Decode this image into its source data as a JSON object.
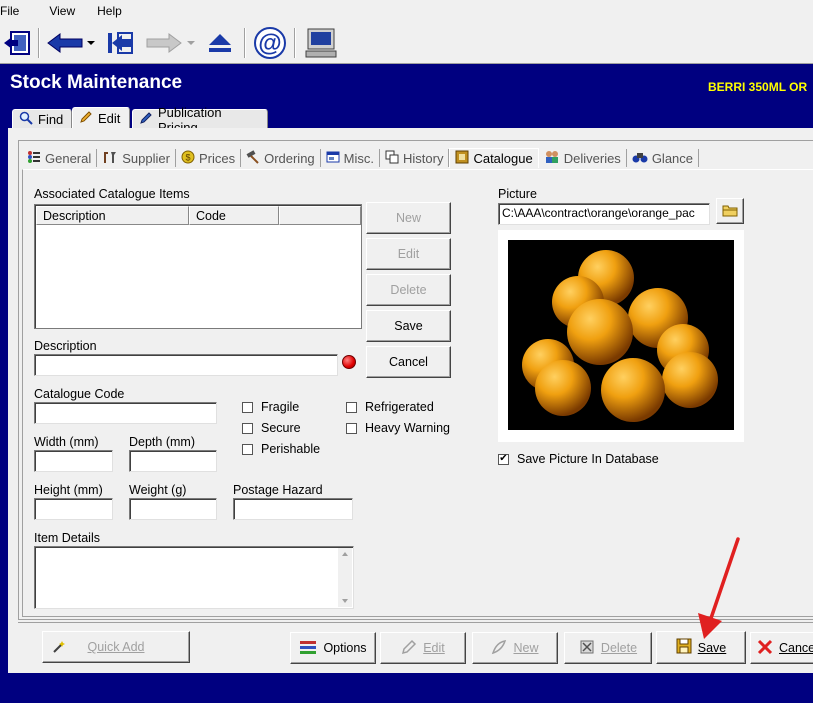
{
  "menu": {
    "file": "File",
    "view": "View",
    "help": "Help"
  },
  "toolbar": {
    "icons": [
      "exit-icon",
      "back-icon",
      "dropdown-icon",
      "first-icon",
      "forward-icon",
      "dropdown-icon",
      "eject-icon",
      "email-icon",
      "terminal-icon"
    ]
  },
  "header": {
    "title": "Stock Maintenance",
    "item_title": "BERRI 350ML OR"
  },
  "tabs": [
    {
      "label": "Find",
      "icon": "magnifier-icon"
    },
    {
      "label": "Edit",
      "icon": "pencil-icon"
    },
    {
      "label": "Publication Pricing",
      "icon": "pen-icon"
    }
  ],
  "subtabs": [
    {
      "label": "General"
    },
    {
      "label": "Supplier"
    },
    {
      "label": "Prices"
    },
    {
      "label": "Ordering"
    },
    {
      "label": "Misc."
    },
    {
      "label": "History"
    },
    {
      "label": "Catalogue"
    },
    {
      "label": "Deliveries"
    },
    {
      "label": "Glance"
    }
  ],
  "catalogue": {
    "assoc_label": "Associated Catalogue Items",
    "columns": [
      "Description",
      "Code",
      ""
    ],
    "buttons": {
      "new": "New",
      "edit": "Edit",
      "delete": "Delete",
      "save": "Save",
      "cancel": "Cancel"
    },
    "description_label": "Description",
    "description_value": "",
    "catalogue_code_label": "Catalogue Code",
    "catalogue_code_value": "",
    "width_label": "Width (mm)",
    "depth_label": "Depth (mm)",
    "height_label": "Height (mm)",
    "weight_label": "Weight (g)",
    "postage_label": "Postage Hazard",
    "item_details_label": "Item Details",
    "checkboxes": {
      "fragile": {
        "label": "Fragile",
        "checked": false
      },
      "secure": {
        "label": "Secure",
        "checked": false
      },
      "perishable": {
        "label": "Perishable",
        "checked": false
      },
      "refrigerated": {
        "label": "Refrigerated",
        "checked": false
      },
      "heavy_warning": {
        "label": "Heavy Warning",
        "checked": false
      }
    },
    "picture_label": "Picture",
    "picture_path": "C:\\AAA\\contract\\orange\\orange_pac",
    "save_picture": {
      "label": "Save Picture In Database",
      "checked": true
    }
  },
  "bottom": {
    "quick_add": "Quick Add",
    "options": "Options",
    "edit": "Edit",
    "new": "New",
    "delete": "Delete",
    "save": "Save",
    "cancel": "Cance"
  },
  "colors": {
    "background": "#000080",
    "title": "#ffffff",
    "item_title": "#ffff00",
    "annotation_arrow": "#e02020"
  }
}
